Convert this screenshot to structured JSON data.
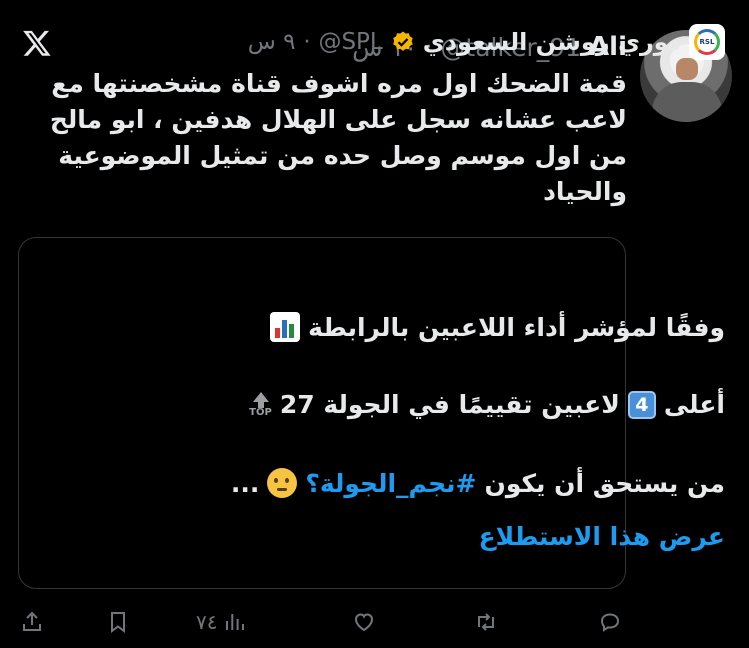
{
  "tweet": {
    "author_name": "Ali",
    "author_handle": "@talker_91",
    "separator": "·",
    "time": "١٠ س",
    "text": "قمة الضحك اول مره اشوف قناة مشخصنتها مع لاعب عشانه سجل على الهلال هدفين ، ابو مالح من اول موسم وصل حده من تمثيل الموضوعية والحياد"
  },
  "quote": {
    "name": "دوري روشن السعودي",
    "handle": "@SPL",
    "separator": "·",
    "time": "٩ س",
    "line1": "وفقًا لمؤشر أداء اللاعبين بالرابطة",
    "line2_prefix": "أعلى",
    "line2_number": "4",
    "line2_suffix": "لاعبين تقييمًا في الجولة 27",
    "line2_badge": "TOP",
    "line3_prefix": "من يستحق أن يكون",
    "line3_hashtag": "#نجم_الجولة؟",
    "line3_suffix": "...",
    "show_poll": "عرض هذا الاستطلاع",
    "logo_text": "RSL"
  },
  "actions": {
    "views_count": "٧٤"
  },
  "icons": {
    "logo": "x-logo-icon",
    "verified": "verified-badge-icon",
    "chart": "bar-chart-emoji",
    "thinking": "thinking-face-emoji",
    "share": "share-icon",
    "bookmark": "bookmark-icon",
    "views": "views-icon",
    "like": "heart-icon",
    "retweet": "retweet-icon",
    "reply": "reply-icon"
  },
  "colors": {
    "background": "#000000",
    "text": "#e7e9ea",
    "muted": "#71767b",
    "link": "#1d9bf0",
    "verified": "#f4b400"
  }
}
